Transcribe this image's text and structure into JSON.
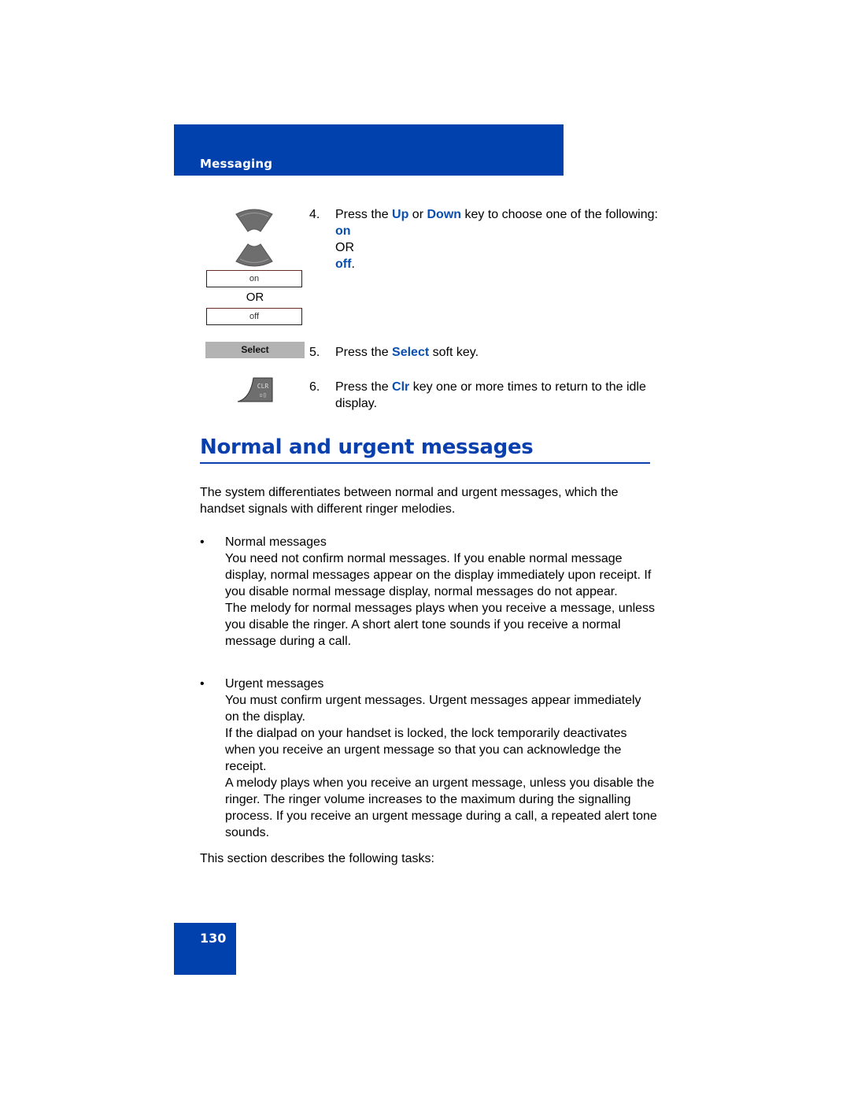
{
  "header": {
    "section": "Messaging"
  },
  "icons": {
    "up_key": "up-arrow-key-icon",
    "down_key": "down-arrow-key-icon",
    "clr_key": "clr-key-icon"
  },
  "display": {
    "option_on": "on",
    "or_label": "OR",
    "option_off": "off",
    "softkey_select": "Select"
  },
  "steps": [
    {
      "number": "4.",
      "text_a": "Press the ",
      "kw_1": "Up",
      "text_b": " or ",
      "kw_2": "Down",
      "text_c": " key to choose one of the following:",
      "option_on": "on",
      "or_label": "OR",
      "option_off": "off",
      "suffix": "."
    },
    {
      "number": "5.",
      "text_a": "Press the ",
      "kw_1": "Select",
      "text_b": " soft key."
    },
    {
      "number": "6.",
      "text_a": "Press the ",
      "kw_1": "Clr",
      "text_b": " key one or more times to return to the idle display."
    }
  ],
  "section": {
    "title": "Normal and urgent messages",
    "intro": "The system differentiates between normal and urgent messages, which the handset signals with different ringer melodies.",
    "bullets": [
      {
        "title": "Normal messages",
        "paragraphs": [
          "You need not confirm normal messages. If you enable normal message display, normal messages appear on the display immediately upon receipt. If you disable normal message display, normal messages do not appear.",
          "The melody for normal messages plays when you receive a message, unless you disable the ringer. A short alert tone sounds if you receive a normal message during a call."
        ]
      },
      {
        "title": "Urgent messages",
        "paragraphs": [
          "You must confirm urgent messages. Urgent messages appear immediately on the display.",
          "If the dialpad on your handset is locked, the lock temporarily deactivates when you receive an urgent message so that you can acknowledge the receipt.",
          "A melody plays when you receive an urgent message, unless you disable the ringer. The ringer volume increases to the maximum during the signalling process. If you receive an urgent message during a call, a repeated alert tone sounds."
        ]
      }
    ],
    "outro": "This section describes the following tasks:"
  },
  "footer": {
    "page_number": "130"
  },
  "colors": {
    "brand_blue": "#0041ad",
    "keyword_blue": "#0a4fb0"
  }
}
